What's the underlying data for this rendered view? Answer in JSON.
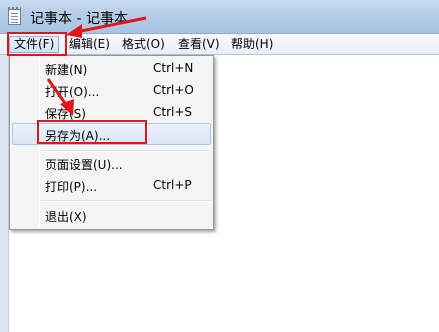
{
  "window": {
    "title": "记事本 - 记事本"
  },
  "menubar": {
    "items": [
      {
        "label": "文件(F)"
      },
      {
        "label": "编辑(E)"
      },
      {
        "label": "格式(O)"
      },
      {
        "label": "查看(V)"
      },
      {
        "label": "帮助(H)"
      }
    ]
  },
  "file_menu": {
    "items": [
      {
        "label": "新建(N)",
        "shortcut": "Ctrl+N"
      },
      {
        "label": "打开(O)...",
        "shortcut": "Ctrl+O"
      },
      {
        "label": "保存(S)",
        "shortcut": "Ctrl+S"
      },
      {
        "label": "另存为(A)...",
        "shortcut": ""
      },
      {
        "label": "页面设置(U)...",
        "shortcut": ""
      },
      {
        "label": "打印(P)...",
        "shortcut": "Ctrl+P"
      },
      {
        "label": "退出(X)",
        "shortcut": ""
      }
    ]
  },
  "annotations": {
    "color": "#e0161b"
  }
}
